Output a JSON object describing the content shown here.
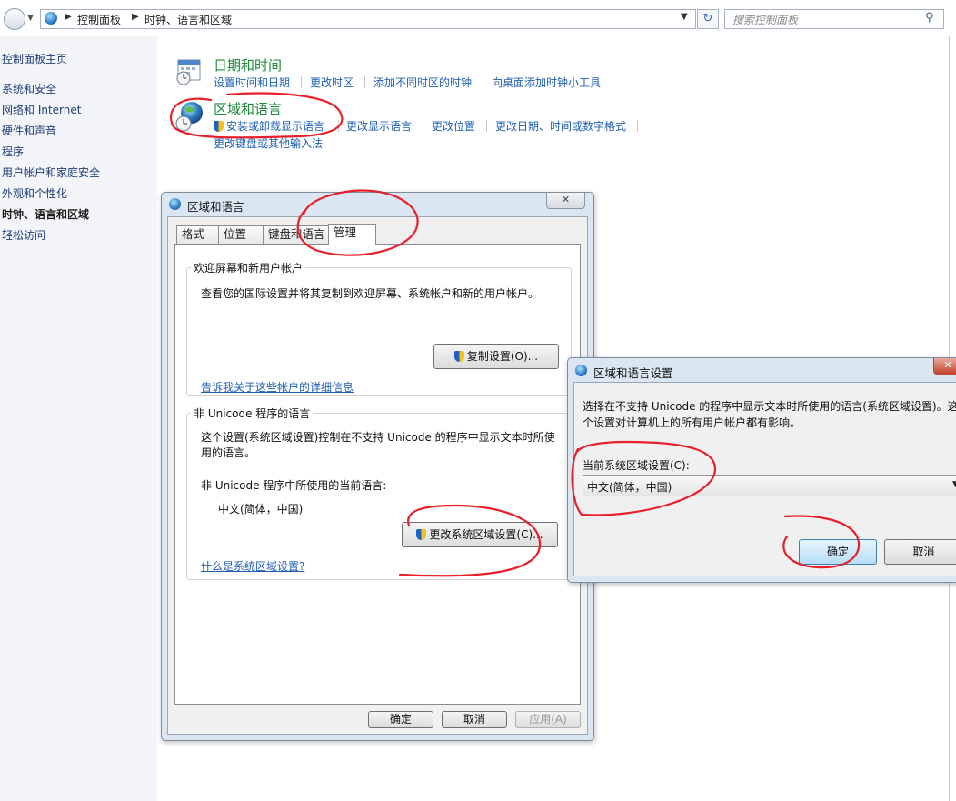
{
  "address_bar": {
    "breadcrumbs": [
      "控制面板",
      "时钟、语言和区域"
    ],
    "search_placeholder": "搜索控制面板"
  },
  "sidebar": {
    "items": [
      {
        "label": "控制面板主页"
      },
      {
        "label": "系统和安全"
      },
      {
        "label": "网络和 Internet"
      },
      {
        "label": "硬件和声音"
      },
      {
        "label": "程序"
      },
      {
        "label": "用户帐户和家庭安全"
      },
      {
        "label": "外观和个性化"
      },
      {
        "label": "时钟、语言和区域",
        "current": true
      },
      {
        "label": "轻松访问"
      }
    ]
  },
  "categories": [
    {
      "title": "日期和时间",
      "icon": "calendar-clock-icon",
      "links": [
        "设置时间和日期",
        "更改时区",
        "添加不同时区的时钟",
        "向桌面添加时钟小工具"
      ]
    },
    {
      "title": "区域和语言",
      "icon": "globe-clock-icon",
      "links": [
        "安装或卸载显示语言",
        "更改显示语言",
        "更改位置",
        "更改日期、时间或数字格式",
        "更改键盘或其他输入法"
      ]
    }
  ],
  "region_dialog": {
    "title": "区域和语言",
    "tabs": [
      "格式",
      "位置",
      "键盘和语言",
      "管理"
    ],
    "active_tab": "管理",
    "welcome_group": {
      "title": "欢迎屏幕和新用户帐户",
      "description": "查看您的国际设置并将其复制到欢迎屏幕、系统帐户和新的用户帐户。",
      "copy_button": "复制设置(O)...",
      "info_link": "告诉我关于这些帐户的详细信息"
    },
    "unicode_group": {
      "title": "非 Unicode 程序的语言",
      "description_line1": "这个设置(系统区域设置)控制在不支持 Unicode 的程序中显示文本时所使",
      "description_line2": "用的语言。",
      "current_label": "非 Unicode 程序中所使用的当前语言:",
      "current_value": "中文(简体，中国)",
      "change_button": "更改系统区域设置(C)...",
      "help_link": "什么是系统区域设置?"
    },
    "buttons": {
      "ok": "确定",
      "cancel": "取消",
      "apply": "应用(A)"
    }
  },
  "locale_dialog": {
    "title": "区域和语言设置",
    "description_line1": "选择在不支持 Unicode 的程序中显示文本时所使用的语言(系统区域设置)。这",
    "description_line2": "个设置对计算机上的所有用户帐户都有影响。",
    "field_label": "当前系统区域设置(C):",
    "selected_value": "中文(简体，中国)",
    "buttons": {
      "ok": "确定",
      "cancel": "取消"
    }
  },
  "annotation_color": "#e8202a"
}
